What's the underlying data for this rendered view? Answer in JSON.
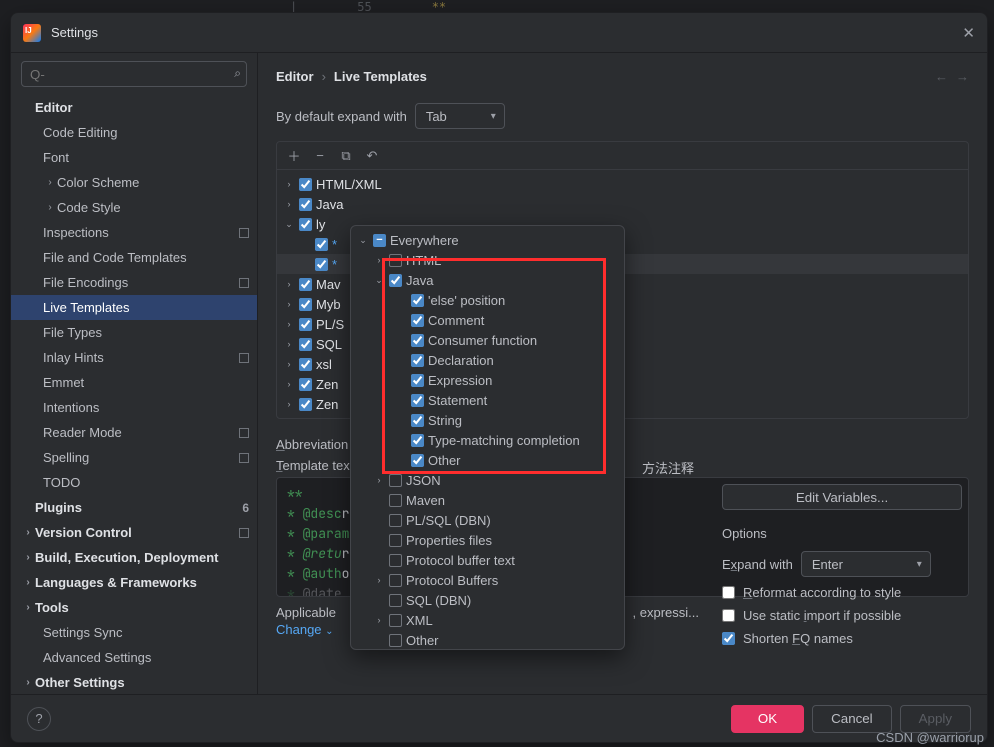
{
  "window": {
    "title": "Settings"
  },
  "breadcrumb": {
    "a": "Editor",
    "b": "Live Templates"
  },
  "search": {
    "placeholder": "Q-"
  },
  "sidebar": {
    "editor": "Editor",
    "items": [
      "Code Editing",
      "Font",
      "Color Scheme",
      "Code Style",
      "Inspections",
      "File and Code Templates",
      "File Encodings",
      "Live Templates",
      "File Types",
      "Inlay Hints",
      "Emmet",
      "Intentions",
      "Reader Mode",
      "Spelling",
      "TODO"
    ],
    "plugins": "Plugins",
    "plugins_count": "6",
    "version_control": "Version Control",
    "build": "Build, Execution, Deployment",
    "lang": "Languages & Frameworks",
    "tools": "Tools",
    "settings_sync": "Settings Sync",
    "advanced": "Advanced Settings",
    "other": "Other Settings"
  },
  "expand": {
    "label": "By default expand with",
    "value": "Tab"
  },
  "template_groups": [
    {
      "name": "HTML/XML",
      "expanded": false,
      "checked": true
    },
    {
      "name": "Java",
      "expanded": false,
      "checked": true
    },
    {
      "name": "ly",
      "expanded": true,
      "checked": true,
      "children": [
        {
          "name": "*",
          "checked": true
        },
        {
          "name": "*",
          "checked": true,
          "sel": true
        }
      ]
    },
    {
      "name": "Mav",
      "expanded": false,
      "checked": true
    },
    {
      "name": "Myb",
      "expanded": false,
      "checked": true
    },
    {
      "name": "PL/S",
      "expanded": false,
      "checked": true
    },
    {
      "name": "SQL",
      "expanded": false,
      "checked": true
    },
    {
      "name": "xsl",
      "expanded": false,
      "checked": true
    },
    {
      "name": "Zen",
      "expanded": false,
      "checked": true
    },
    {
      "name": "Zen",
      "expanded": false,
      "checked": true
    }
  ],
  "popup": {
    "root": "Everywhere",
    "items": [
      {
        "label": "HTML",
        "depth": 1,
        "checked": "empty",
        "arrow": ">"
      },
      {
        "label": "Java",
        "depth": 1,
        "checked": true,
        "arrow": "v"
      },
      {
        "label": "'else' position",
        "depth": 2,
        "checked": true
      },
      {
        "label": "Comment",
        "depth": 2,
        "checked": true
      },
      {
        "label": "Consumer function",
        "depth": 2,
        "checked": true
      },
      {
        "label": "Declaration",
        "depth": 2,
        "checked": true
      },
      {
        "label": "Expression",
        "depth": 2,
        "checked": true
      },
      {
        "label": "Statement",
        "depth": 2,
        "checked": true
      },
      {
        "label": "String",
        "depth": 2,
        "checked": true
      },
      {
        "label": "Type-matching completion",
        "depth": 2,
        "checked": true
      },
      {
        "label": "Other",
        "depth": 2,
        "checked": true
      },
      {
        "label": "JSON",
        "depth": 1,
        "checked": "empty",
        "arrow": ">"
      },
      {
        "label": "Maven",
        "depth": 1,
        "checked": "empty"
      },
      {
        "label": "PL/SQL (DBN)",
        "depth": 1,
        "checked": "empty"
      },
      {
        "label": "Properties files",
        "depth": 1,
        "checked": "empty"
      },
      {
        "label": "Protocol buffer text",
        "depth": 1,
        "checked": "empty"
      },
      {
        "label": "Protocol Buffers",
        "depth": 1,
        "checked": "empty",
        "arrow": ">"
      },
      {
        "label": "SQL (DBN)",
        "depth": 1,
        "checked": "empty"
      },
      {
        "label": "XML",
        "depth": 1,
        "checked": "empty",
        "arrow": ">"
      },
      {
        "label": "Other",
        "depth": 1,
        "checked": "empty"
      }
    ]
  },
  "abbreviation": {
    "label": "Abbreviation"
  },
  "template_text": {
    "label": "Template text:"
  },
  "code": {
    "l1": "**",
    "l2": "* @descr",
    "l3": "* @param",
    "l4": "* @retur",
    "l5": "* @autho",
    "l6": "* @date"
  },
  "desc_hint": "方法注释",
  "applicable": {
    "text": "Applicable",
    "tail": ", expressi...",
    "change": "Change"
  },
  "edit_vars": "Edit Variables...",
  "options": {
    "title": "Options",
    "expand_with_label": "Expand with",
    "expand_with_value": "Enter",
    "reformat": "Reformat according to style",
    "static_import": "Use static import if possible",
    "shorten": "Shorten FQ names"
  },
  "footer": {
    "ok": "OK",
    "cancel": "Cancel",
    "apply": "Apply"
  },
  "bg": {
    "line": "55",
    "stars": "**"
  },
  "watermark": "CSDN @warriorup"
}
